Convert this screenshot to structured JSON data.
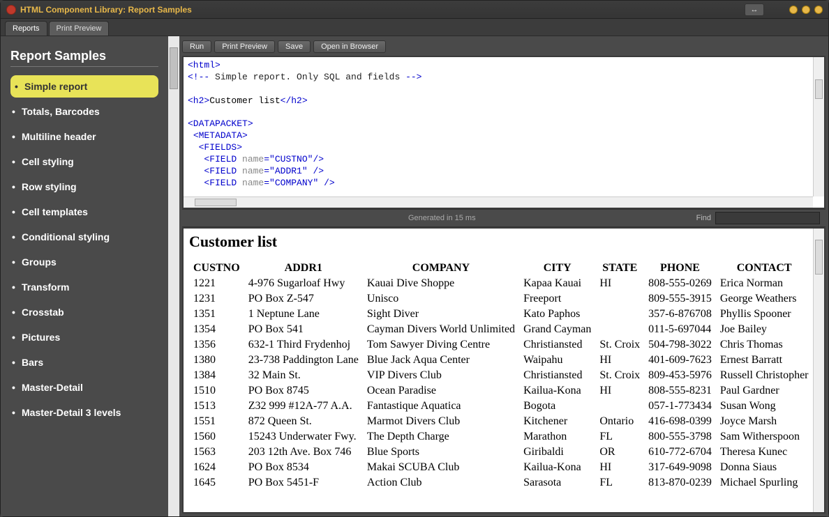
{
  "window": {
    "title": "HTML Component Library: Report Samples"
  },
  "tabs": [
    {
      "label": "Reports",
      "active": true
    },
    {
      "label": "Print Preview",
      "active": false
    }
  ],
  "sidebar": {
    "heading": "Report Samples",
    "items": [
      "Simple report",
      "Totals, Barcodes",
      "Multiline header",
      "Cell styling",
      "Row styling",
      "Cell templates",
      "Conditional styling",
      "Groups",
      "Transform",
      "Crosstab",
      "Pictures",
      "Bars",
      "Master-Detail",
      "Master-Detail 3 levels"
    ],
    "selectedIndex": 0
  },
  "toolbar": {
    "run": "Run",
    "printPreview": "Print Preview",
    "save": "Save",
    "openInBrowser": "Open in Browser"
  },
  "code": {
    "l1a": "<html>",
    "l2a": "<!-- ",
    "l2b": "Simple report. Only SQL and fields",
    "l2c": " -->",
    "l4a": "<h2>",
    "l4b": "Customer list",
    "l4c": "</h2>",
    "l6": "<DATAPACKET>",
    "l7": "<METADATA>",
    "l8": "<FIELDS>",
    "l9a": "<FIELD ",
    "l9b": "name",
    "l9c": "=\"CUSTNO\"",
    "l9d": "/>",
    "l10a": "<FIELD ",
    "l10b": "name",
    "l10c": "=\"ADDR1\" ",
    "l10d": "/>",
    "l11a": "<FIELD ",
    "l11b": "name",
    "l11c": "=\"COMPANY\" ",
    "l11d": "/>"
  },
  "status": {
    "generated": "Generated in 15 ms",
    "findLabel": "Find"
  },
  "report": {
    "title": "Customer list",
    "columns": [
      "CUSTNO",
      "ADDR1",
      "COMPANY",
      "CITY",
      "STATE",
      "PHONE",
      "CONTACT"
    ],
    "rows": [
      [
        "1221",
        "4-976 Sugarloaf Hwy",
        "Kauai Dive Shoppe",
        "Kapaa Kauai",
        "HI",
        "808-555-0269",
        "Erica Norman"
      ],
      [
        "1231",
        "PO Box Z-547",
        "Unisco",
        "Freeport",
        "",
        "809-555-3915",
        "George Weathers"
      ],
      [
        "1351",
        "1 Neptune Lane",
        "Sight Diver",
        "Kato Paphos",
        "",
        "357-6-876708",
        "Phyllis Spooner"
      ],
      [
        "1354",
        "PO Box 541",
        "Cayman Divers World Unlimited",
        "Grand Cayman",
        "",
        "011-5-697044",
        "Joe Bailey"
      ],
      [
        "1356",
        "632-1 Third Frydenhoj",
        "Tom Sawyer Diving Centre",
        "Christiansted",
        "St. Croix",
        "504-798-3022",
        "Chris Thomas"
      ],
      [
        "1380",
        "23-738 Paddington Lane",
        "Blue Jack Aqua Center",
        "Waipahu",
        "HI",
        "401-609-7623",
        "Ernest Barratt"
      ],
      [
        "1384",
        "32 Main St.",
        "VIP Divers Club",
        "Christiansted",
        "St. Croix",
        "809-453-5976",
        "Russell Christopher"
      ],
      [
        "1510",
        "PO Box 8745",
        "Ocean Paradise",
        "Kailua-Kona",
        "HI",
        "808-555-8231",
        "Paul Gardner"
      ],
      [
        "1513",
        "Z32 999 #12A-77 A.A.",
        "Fantastique Aquatica",
        "Bogota",
        "",
        "057-1-773434",
        "Susan Wong"
      ],
      [
        "1551",
        "872 Queen St.",
        "Marmot Divers Club",
        "Kitchener",
        "Ontario",
        "416-698-0399",
        "Joyce Marsh"
      ],
      [
        "1560",
        "15243 Underwater Fwy.",
        "The Depth Charge",
        "Marathon",
        "FL",
        "800-555-3798",
        "Sam Witherspoon"
      ],
      [
        "1563",
        "203 12th Ave. Box 746",
        "Blue Sports",
        "Giribaldi",
        "OR",
        "610-772-6704",
        "Theresa Kunec"
      ],
      [
        "1624",
        "PO Box 8534",
        "Makai SCUBA Club",
        "Kailua-Kona",
        "HI",
        "317-649-9098",
        "Donna Siaus"
      ],
      [
        "1645",
        "PO Box 5451-F",
        "Action Club",
        "Sarasota",
        "FL",
        "813-870-0239",
        "Michael Spurling"
      ]
    ]
  }
}
